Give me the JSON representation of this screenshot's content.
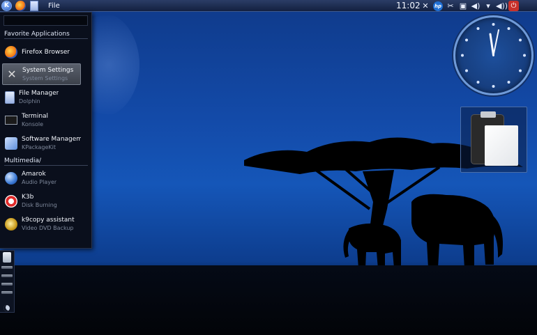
{
  "panel": {
    "file_menu": "File",
    "clock": "11:02",
    "tray_icons": [
      "network-tools-icon",
      "hp-icon",
      "scissors-icon",
      "clipboard-icon",
      "volume-icon",
      "dropdown-icon",
      "speaker-icon",
      "power-icon"
    ]
  },
  "menu": {
    "favorites_title": "Favorite Applications",
    "multimedia_title": "Multimedia/",
    "items": [
      {
        "name": "Firefox Browser",
        "sub": ""
      },
      {
        "name": "System Settings",
        "sub": "System Settings"
      },
      {
        "name": "File Manager",
        "sub": "Dolphin"
      },
      {
        "name": "Terminal",
        "sub": "Konsole"
      },
      {
        "name": "Software Management",
        "sub": "KPackageKit"
      },
      {
        "name": "Amarok",
        "sub": "Audio Player"
      },
      {
        "name": "K3b",
        "sub": "Disk Burning"
      },
      {
        "name": "k9copy assistant",
        "sub": "Video DVD Backup"
      }
    ]
  },
  "colors": {
    "sky": "#134aa8",
    "menu_bg": "#0a0f1c",
    "selected": "#4a505b"
  }
}
